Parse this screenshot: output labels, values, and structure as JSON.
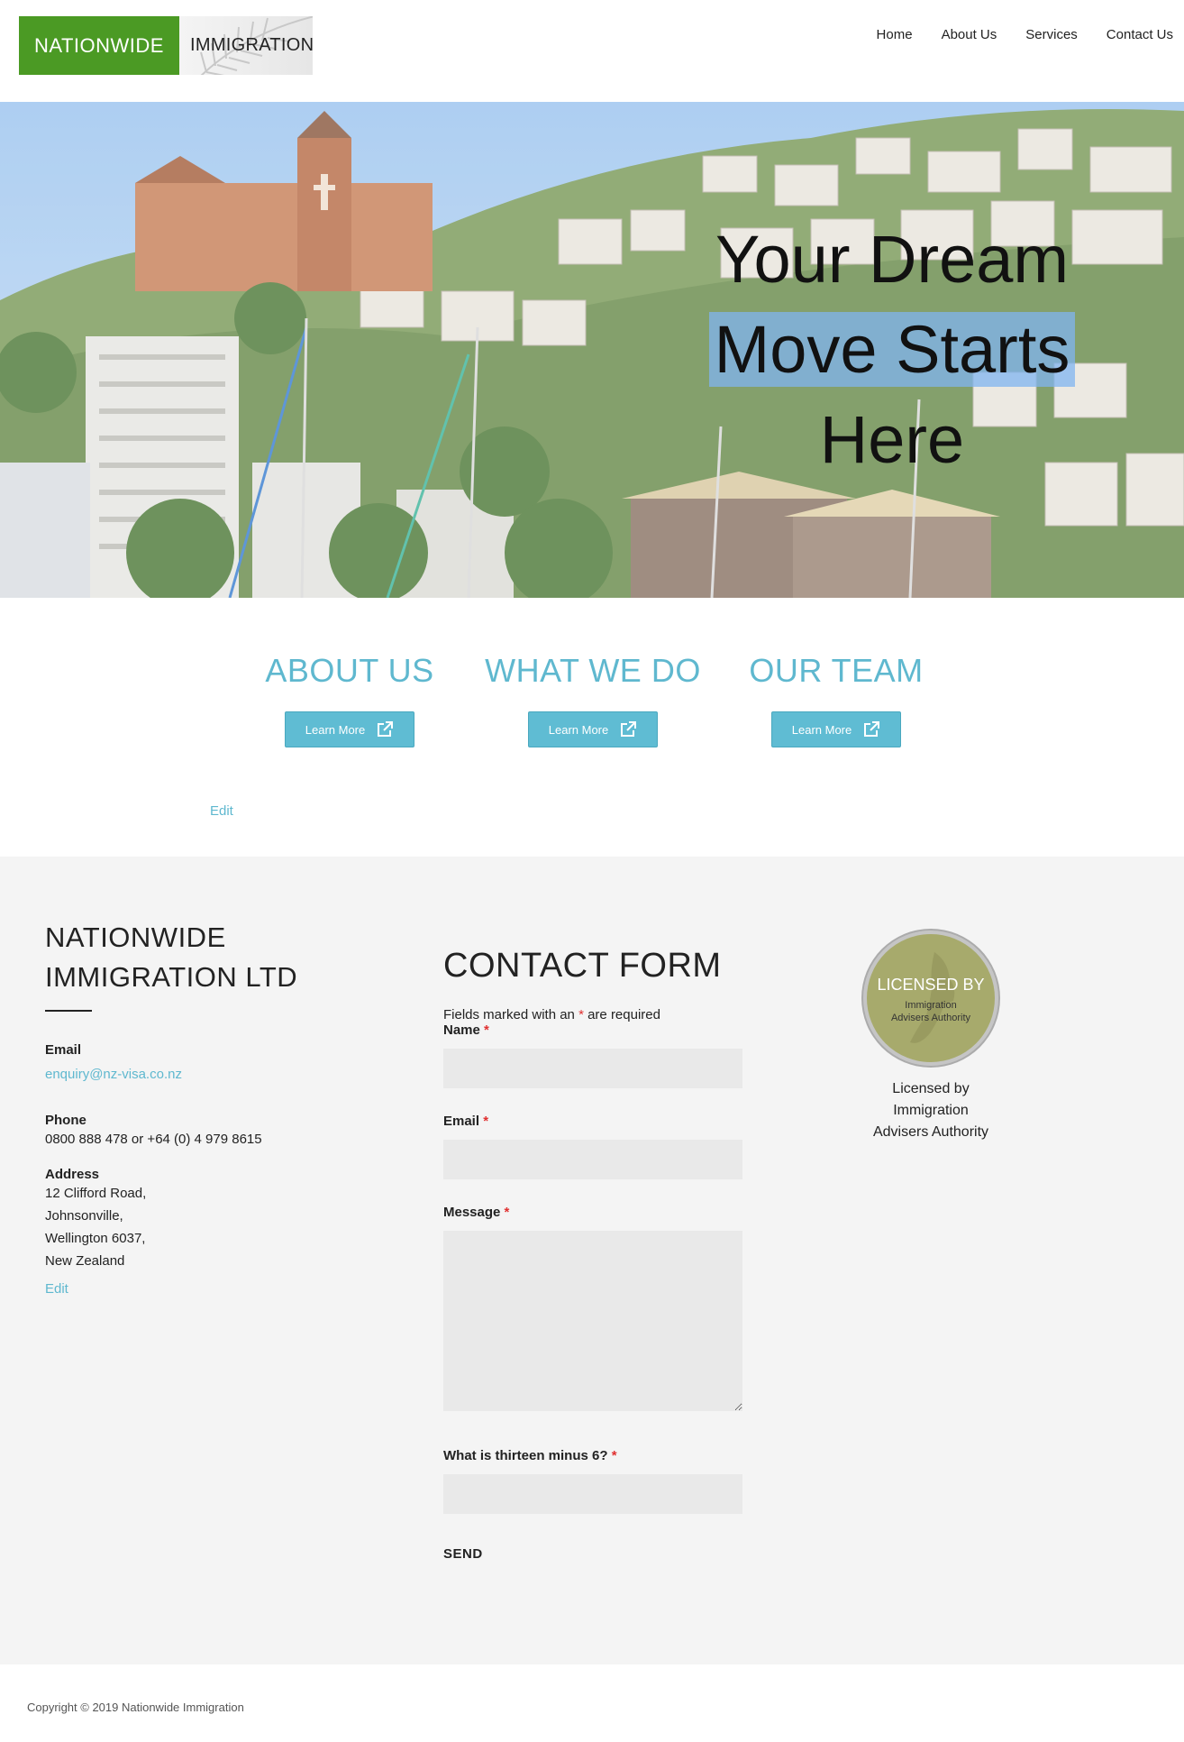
{
  "logo": {
    "left_text": "NATIONWIDE",
    "right_text": "IMMIGRATION"
  },
  "nav": {
    "items": [
      "Home",
      "About Us",
      "Services",
      "Contact Us"
    ]
  },
  "hero": {
    "line1": "Your Dream",
    "line2": "Move Starts",
    "line3": "Here"
  },
  "features": [
    {
      "title": "ABOUT US",
      "button": "Learn More"
    },
    {
      "title": "WHAT WE DO",
      "button": "Learn More"
    },
    {
      "title": "OUR TEAM",
      "button": "Learn More"
    }
  ],
  "features_edit": "Edit",
  "company": {
    "name_line1": "NATIONWIDE",
    "name_line2": "IMMIGRATION LTD",
    "email_label": "Email",
    "email": "enquiry@nz-visa.co.nz",
    "phone_label": "Phone",
    "phone": "0800 888 478 or +64 (0) 4 979 8615",
    "address_label": "Address",
    "address": [
      "12 Clifford Road,",
      "Johnsonville,",
      "Wellington 6037,",
      "New Zealand"
    ],
    "edit": "Edit"
  },
  "contact_form": {
    "title": "CONTACT FORM",
    "note_before": "Fields marked with an",
    "note_star": "*",
    "note_after": "are required",
    "name_label": "Name",
    "email_label": "Email",
    "message_label": "Message",
    "captcha_label": "What is thirteen minus 6?",
    "required_star": "*",
    "send": "SEND"
  },
  "badge": {
    "line1": "LICENSED BY",
    "line2": "Immigration",
    "line3": "Advisers Authority",
    "caption": [
      "Licensed by",
      "Immigration",
      "Advisers Authority"
    ]
  },
  "copyright": "Copyright © 2019 Nationwide Immigration",
  "colors": {
    "brand_green": "#4b9a24",
    "accent_teal": "#5fb8cf",
    "button_teal": "#5fbcd3",
    "footer_bg": "#f4f4f4",
    "required_red": "#e03030"
  }
}
